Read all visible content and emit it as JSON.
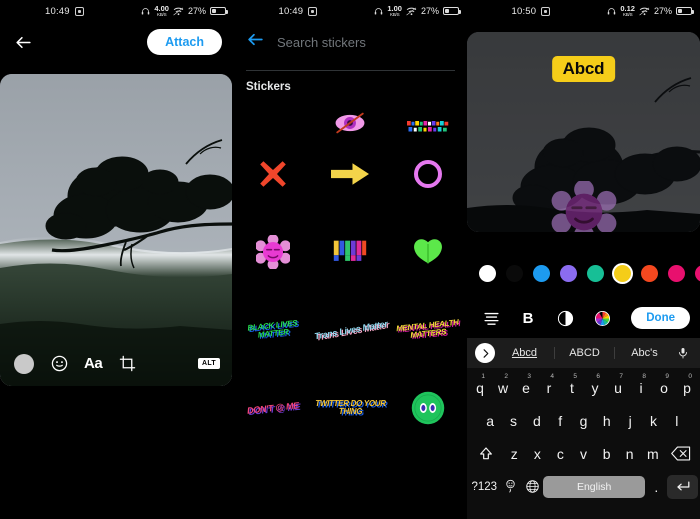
{
  "panels": [
    {
      "id": "composer",
      "status": {
        "time": "10:49",
        "rate_value": "4.00",
        "rate_unit": "KB/S",
        "battery": "27%"
      },
      "header": {
        "back_icon": "arrow-left-icon",
        "attach_label": "Attach"
      },
      "toolbar": {
        "draw_icon": "brush-circle-icon",
        "sticker_icon": "smiley-icon",
        "text_label": "Aa",
        "crop_icon": "crop-icon",
        "alt_label": "ALT"
      }
    },
    {
      "id": "sticker-picker",
      "status": {
        "time": "10:49",
        "rate_value": "1.00",
        "rate_unit": "KB/S",
        "battery": "27%"
      },
      "search": {
        "back_icon": "arrow-left-icon",
        "placeholder": "Search stickers"
      },
      "section_title": "Stickers",
      "stickers": [
        {
          "name": "eye-crossed-sticker",
          "label": ""
        },
        {
          "name": "pixel-text-sticker",
          "label": ""
        },
        {
          "name": "red-cross-sticker",
          "label": ""
        },
        {
          "name": "yellow-arrow-sticker",
          "label": ""
        },
        {
          "name": "pink-ring-sticker",
          "label": ""
        },
        {
          "name": "pink-flower-face-sticker",
          "label": ""
        },
        {
          "name": "color-bars-sticker",
          "label": ""
        },
        {
          "name": "green-butterfly-sticker",
          "label": ""
        },
        {
          "name": "black-lives-matter-sticker",
          "label": "BLACK LIVES MATTER"
        },
        {
          "name": "trans-lives-matter-sticker",
          "label": "Trans Lives Matter"
        },
        {
          "name": "mental-health-matters-sticker",
          "label": "MENTAL HEALTH MATTERS"
        },
        {
          "name": "dont-at-me-sticker",
          "label": "DON'T @ ME"
        },
        {
          "name": "twitter-do-your-thing-sticker",
          "label": "TWITTER DO YOUR THING"
        },
        {
          "name": "green-eyes-badge-sticker",
          "label": ""
        }
      ]
    },
    {
      "id": "text-editor",
      "status": {
        "time": "10:50",
        "rate_value": "0.12",
        "rate_unit": "KB/S",
        "battery": "27%"
      },
      "overlay_text": "Abcd",
      "overlay_bg_color": "#f5cd19",
      "colors": [
        {
          "name": "white",
          "hex": "#ffffff",
          "selected": false
        },
        {
          "name": "black",
          "hex": "#0a0a0a",
          "selected": false
        },
        {
          "name": "blue",
          "hex": "#1d9bf0",
          "selected": false
        },
        {
          "name": "purple",
          "hex": "#8b6cf0",
          "selected": false
        },
        {
          "name": "teal",
          "hex": "#17bf96",
          "selected": false
        },
        {
          "name": "yellow",
          "hex": "#f5cd19",
          "selected": true
        },
        {
          "name": "orange",
          "hex": "#f4481f",
          "selected": false
        },
        {
          "name": "magenta",
          "hex": "#e8106e",
          "selected": false
        },
        {
          "name": "pink",
          "hex": "#e8106e",
          "selected": false
        }
      ],
      "toolbar": {
        "align_icon": "text-align-icon",
        "bold_label": "B",
        "contrast_icon": "contrast-circle-icon",
        "palette_icon": "color-wheel-icon",
        "done_label": "Done"
      },
      "suggestions": {
        "expand_icon": "chevron-right-icon",
        "items": [
          {
            "label": "Abcd",
            "active": true
          },
          {
            "label": "ABCD",
            "active": false
          },
          {
            "label": "Abc's",
            "active": false
          }
        ],
        "mic_icon": "microphone-icon"
      },
      "keyboard": {
        "row1": [
          {
            "key": "q",
            "num": "1"
          },
          {
            "key": "w",
            "num": "2"
          },
          {
            "key": "e",
            "num": "3"
          },
          {
            "key": "r",
            "num": "4"
          },
          {
            "key": "t",
            "num": "5"
          },
          {
            "key": "y",
            "num": "6"
          },
          {
            "key": "u",
            "num": "7"
          },
          {
            "key": "i",
            "num": "8"
          },
          {
            "key": "o",
            "num": "9"
          },
          {
            "key": "p",
            "num": "0"
          }
        ],
        "row2": [
          "a",
          "s",
          "d",
          "f",
          "g",
          "h",
          "j",
          "k",
          "l"
        ],
        "row3": [
          "z",
          "x",
          "c",
          "v",
          "b",
          "n",
          "m"
        ],
        "shift_icon": "shift-arrow-icon",
        "backspace_icon": "backspace-icon",
        "sym_label": "?123",
        "emoji_icon": "emoji-comma-icon",
        "globe_icon": "globe-icon",
        "space_label": "English",
        "period_label": ".",
        "enter_icon": "enter-arrow-icon"
      }
    }
  ]
}
